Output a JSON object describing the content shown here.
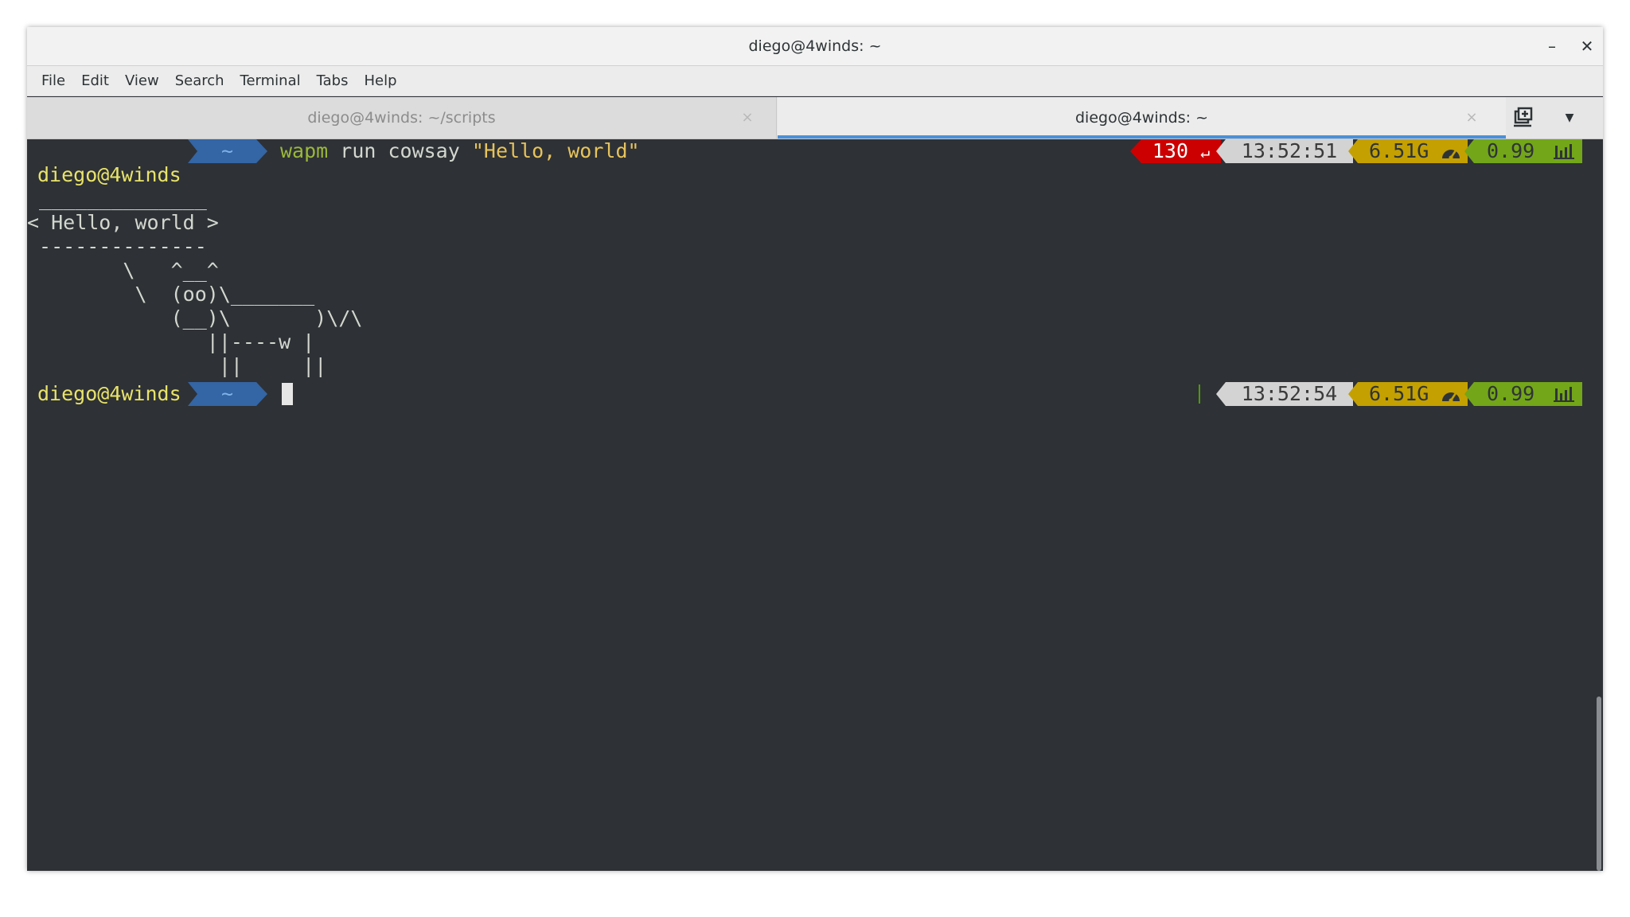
{
  "window": {
    "title": "diego@4winds: ~",
    "minimize_glyph": "–",
    "close_glyph": "✕"
  },
  "menu": [
    "File",
    "Edit",
    "View",
    "Search",
    "Terminal",
    "Tabs",
    "Help"
  ],
  "tabs": [
    {
      "label": "diego@4winds: ~/scripts",
      "active": false,
      "close_glyph": "×"
    },
    {
      "label": "diego@4winds: ~",
      "active": true,
      "close_glyph": "×"
    }
  ],
  "tabbar": {
    "new_tab_icon": "new-tab-icon",
    "menu_glyph": "▼"
  },
  "terminal": {
    "prompt1": {
      "user": "diego@4winds",
      "path": "~",
      "command_name": "wapm",
      "command_args": " run cowsay ",
      "command_string": "\"Hello, world\"",
      "exit_code": "130",
      "exit_glyph": "↵",
      "time": "13:52:51",
      "mem": "6.51G",
      "load": "0.99"
    },
    "output": [
      " ______________",
      "< Hello, world >",
      " --------------",
      "        \\   ^__^",
      "         \\  (oo)\\_______",
      "            (__)\\       )\\/\\",
      "               ||----w |",
      "                ||     ||"
    ],
    "prompt2": {
      "user": "diego@4winds",
      "path": "~",
      "time": "13:52:54",
      "mem": "6.51G",
      "load": "0.99"
    }
  },
  "colors": {
    "terminal_bg": "#2e3135",
    "user": "#e8e36a",
    "path_bg": "#3465a4",
    "exit_bg": "#cc0000",
    "time_bg": "#d3d3d3",
    "mem_bg": "#c4a000",
    "load_bg": "#73a619",
    "tab_accent": "#4a90d9"
  }
}
